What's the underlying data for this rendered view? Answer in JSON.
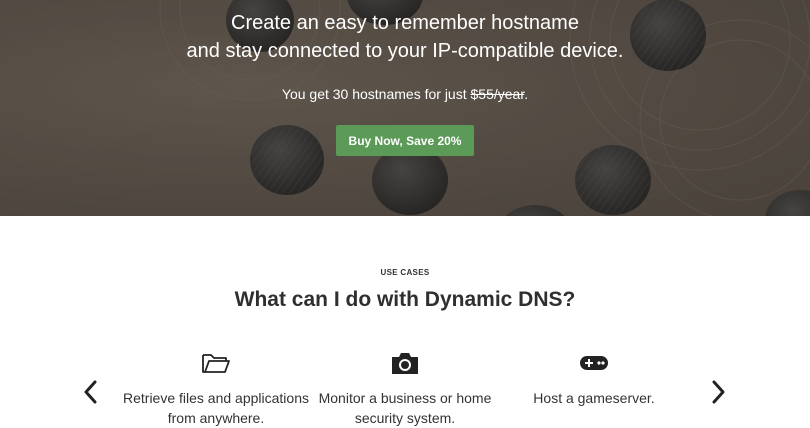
{
  "hero": {
    "title_line1": "Create an easy to remember hostname",
    "title_line2": "and stay connected to your IP-compatible device.",
    "subtitle_prefix": "You get 30 hostnames for just ",
    "subtitle_price": "$55/year",
    "subtitle_suffix": ".",
    "cta_label": "Buy Now, Save 20%",
    "cta_color": "#5b9a57"
  },
  "use_cases": {
    "tag": "USE CASES",
    "title": "What can I do with Dynamic DNS?",
    "items": [
      {
        "icon": "folder-open-icon",
        "text": "Retrieve files and applications from anywhere."
      },
      {
        "icon": "camera-icon",
        "text": "Monitor a business or home security system."
      },
      {
        "icon": "gamepad-icon",
        "text": "Host a gameserver."
      }
    ]
  }
}
